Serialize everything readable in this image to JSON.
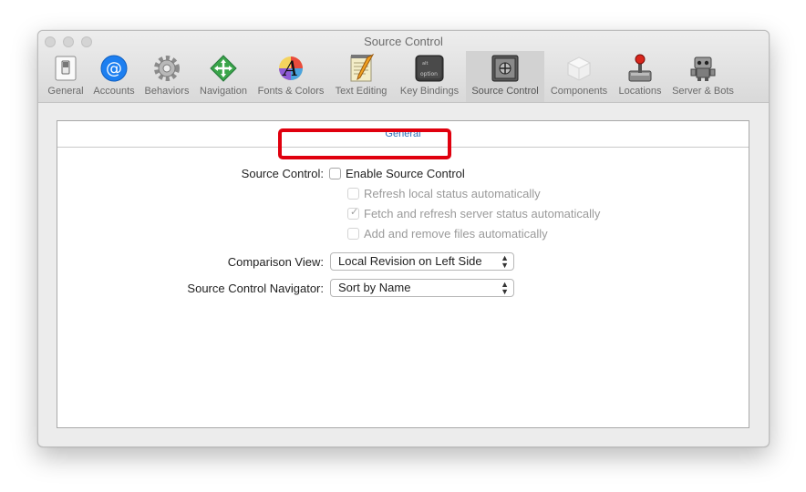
{
  "window": {
    "title": "Source Control"
  },
  "toolbar": {
    "items": [
      {
        "label": "General",
        "icon": "switch-icon",
        "selected": false
      },
      {
        "label": "Accounts",
        "icon": "at-sign-icon",
        "selected": false
      },
      {
        "label": "Behaviors",
        "icon": "gear-icon",
        "selected": false
      },
      {
        "label": "Navigation",
        "icon": "navigation-arrows-icon",
        "selected": false
      },
      {
        "label": "Fonts & Colors",
        "icon": "font-palette-icon",
        "selected": false
      },
      {
        "label": "Text Editing",
        "icon": "notepad-pencil-icon",
        "selected": false
      },
      {
        "label": "Key Bindings",
        "icon": "option-key-icon",
        "selected": false
      },
      {
        "label": "Source Control",
        "icon": "safe-icon",
        "selected": true
      },
      {
        "label": "Components",
        "icon": "component-box-icon",
        "selected": false
      },
      {
        "label": "Locations",
        "icon": "joystick-icon",
        "selected": false
      },
      {
        "label": "Server & Bots",
        "icon": "robot-icon",
        "selected": false
      }
    ]
  },
  "panel": {
    "tab_label": "General",
    "source_control_label": "Source Control:",
    "checkboxes": [
      {
        "label": "Enable Source Control",
        "checked": false,
        "enabled": true
      },
      {
        "label": "Refresh local status automatically",
        "checked": false,
        "enabled": false
      },
      {
        "label": "Fetch and refresh server status automatically",
        "checked": true,
        "enabled": false
      },
      {
        "label": "Add and remove files automatically",
        "checked": false,
        "enabled": false
      }
    ],
    "comparison_view_label": "Comparison View:",
    "comparison_view_value": "Local Revision on Left Side",
    "navigator_label": "Source Control Navigator:",
    "navigator_value": "Sort by Name"
  },
  "colors": {
    "highlight": "#e0000e",
    "tab_text": "#2c6fb7"
  }
}
